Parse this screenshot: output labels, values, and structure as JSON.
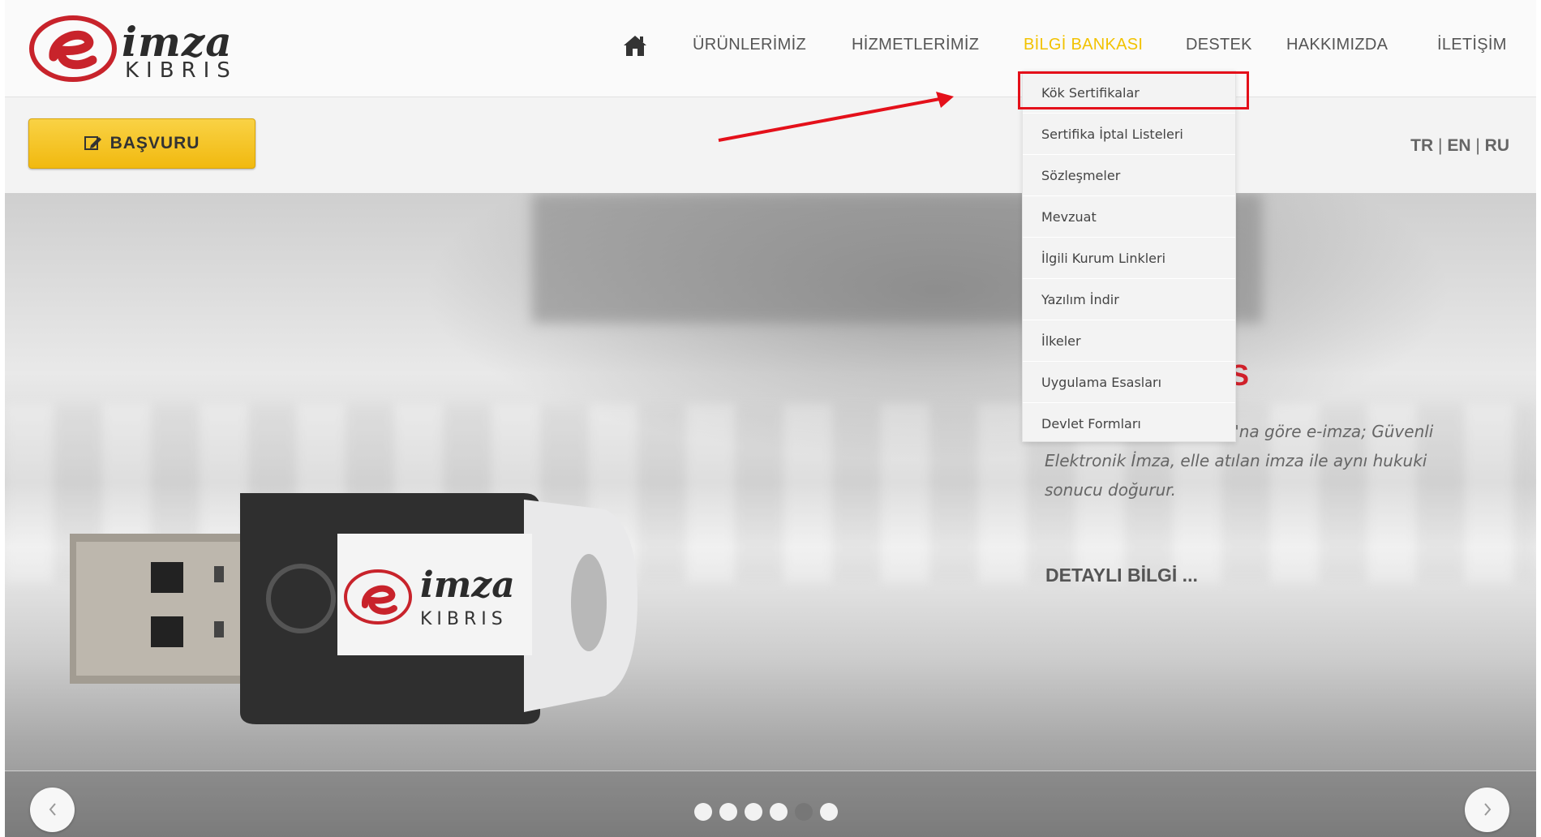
{
  "logo": {
    "brand": "imza",
    "sub": "KIBRIS"
  },
  "nav": {
    "items": [
      {
        "label": "ÜRÜNLERİMİZ"
      },
      {
        "label": "HİZMETLERİMİZ"
      },
      {
        "label": "BİLGİ BANKASI",
        "active": true
      },
      {
        "label": "DESTEK"
      },
      {
        "label": "HAKKIMIZDA"
      },
      {
        "label": "İLETİŞİM"
      }
    ],
    "home_icon": "home-icon",
    "active_color": "#f2c200"
  },
  "dropdown": {
    "items": [
      "Kök Sertifikalar",
      "Sertifika İptal Listeleri",
      "Sözleşmeler",
      "Mevzuat",
      "İlgili Kurum Linkleri",
      "Yazılım İndir",
      "İlkeler",
      "Uygulama Esasları",
      "Devlet Formları"
    ],
    "highlighted_index": 0,
    "highlight_color": "#e4101a"
  },
  "apply_button": {
    "label": "BAŞVURU",
    "icon": "edit-icon",
    "color": "#f3c11c"
  },
  "languages": {
    "tr": "TR",
    "en": "EN",
    "ru": "RU",
    "separator": "|"
  },
  "slide": {
    "title_partial": "IS",
    "text": "ı Elektronik İmza Yasası'na göre e-imza; Güvenli Elektronik İmza, elle atılan imza ile aynı hukuki sonucu doğurur.",
    "more_label": "DETAYLI BİLGİ ...",
    "product_brand": "imza",
    "product_sub": "KIBRIS"
  },
  "slider_nav": {
    "prev_icon": "chevron-left-icon",
    "next_icon": "chevron-right-icon"
  },
  "pagination": {
    "count": 6,
    "active_index": 4
  }
}
